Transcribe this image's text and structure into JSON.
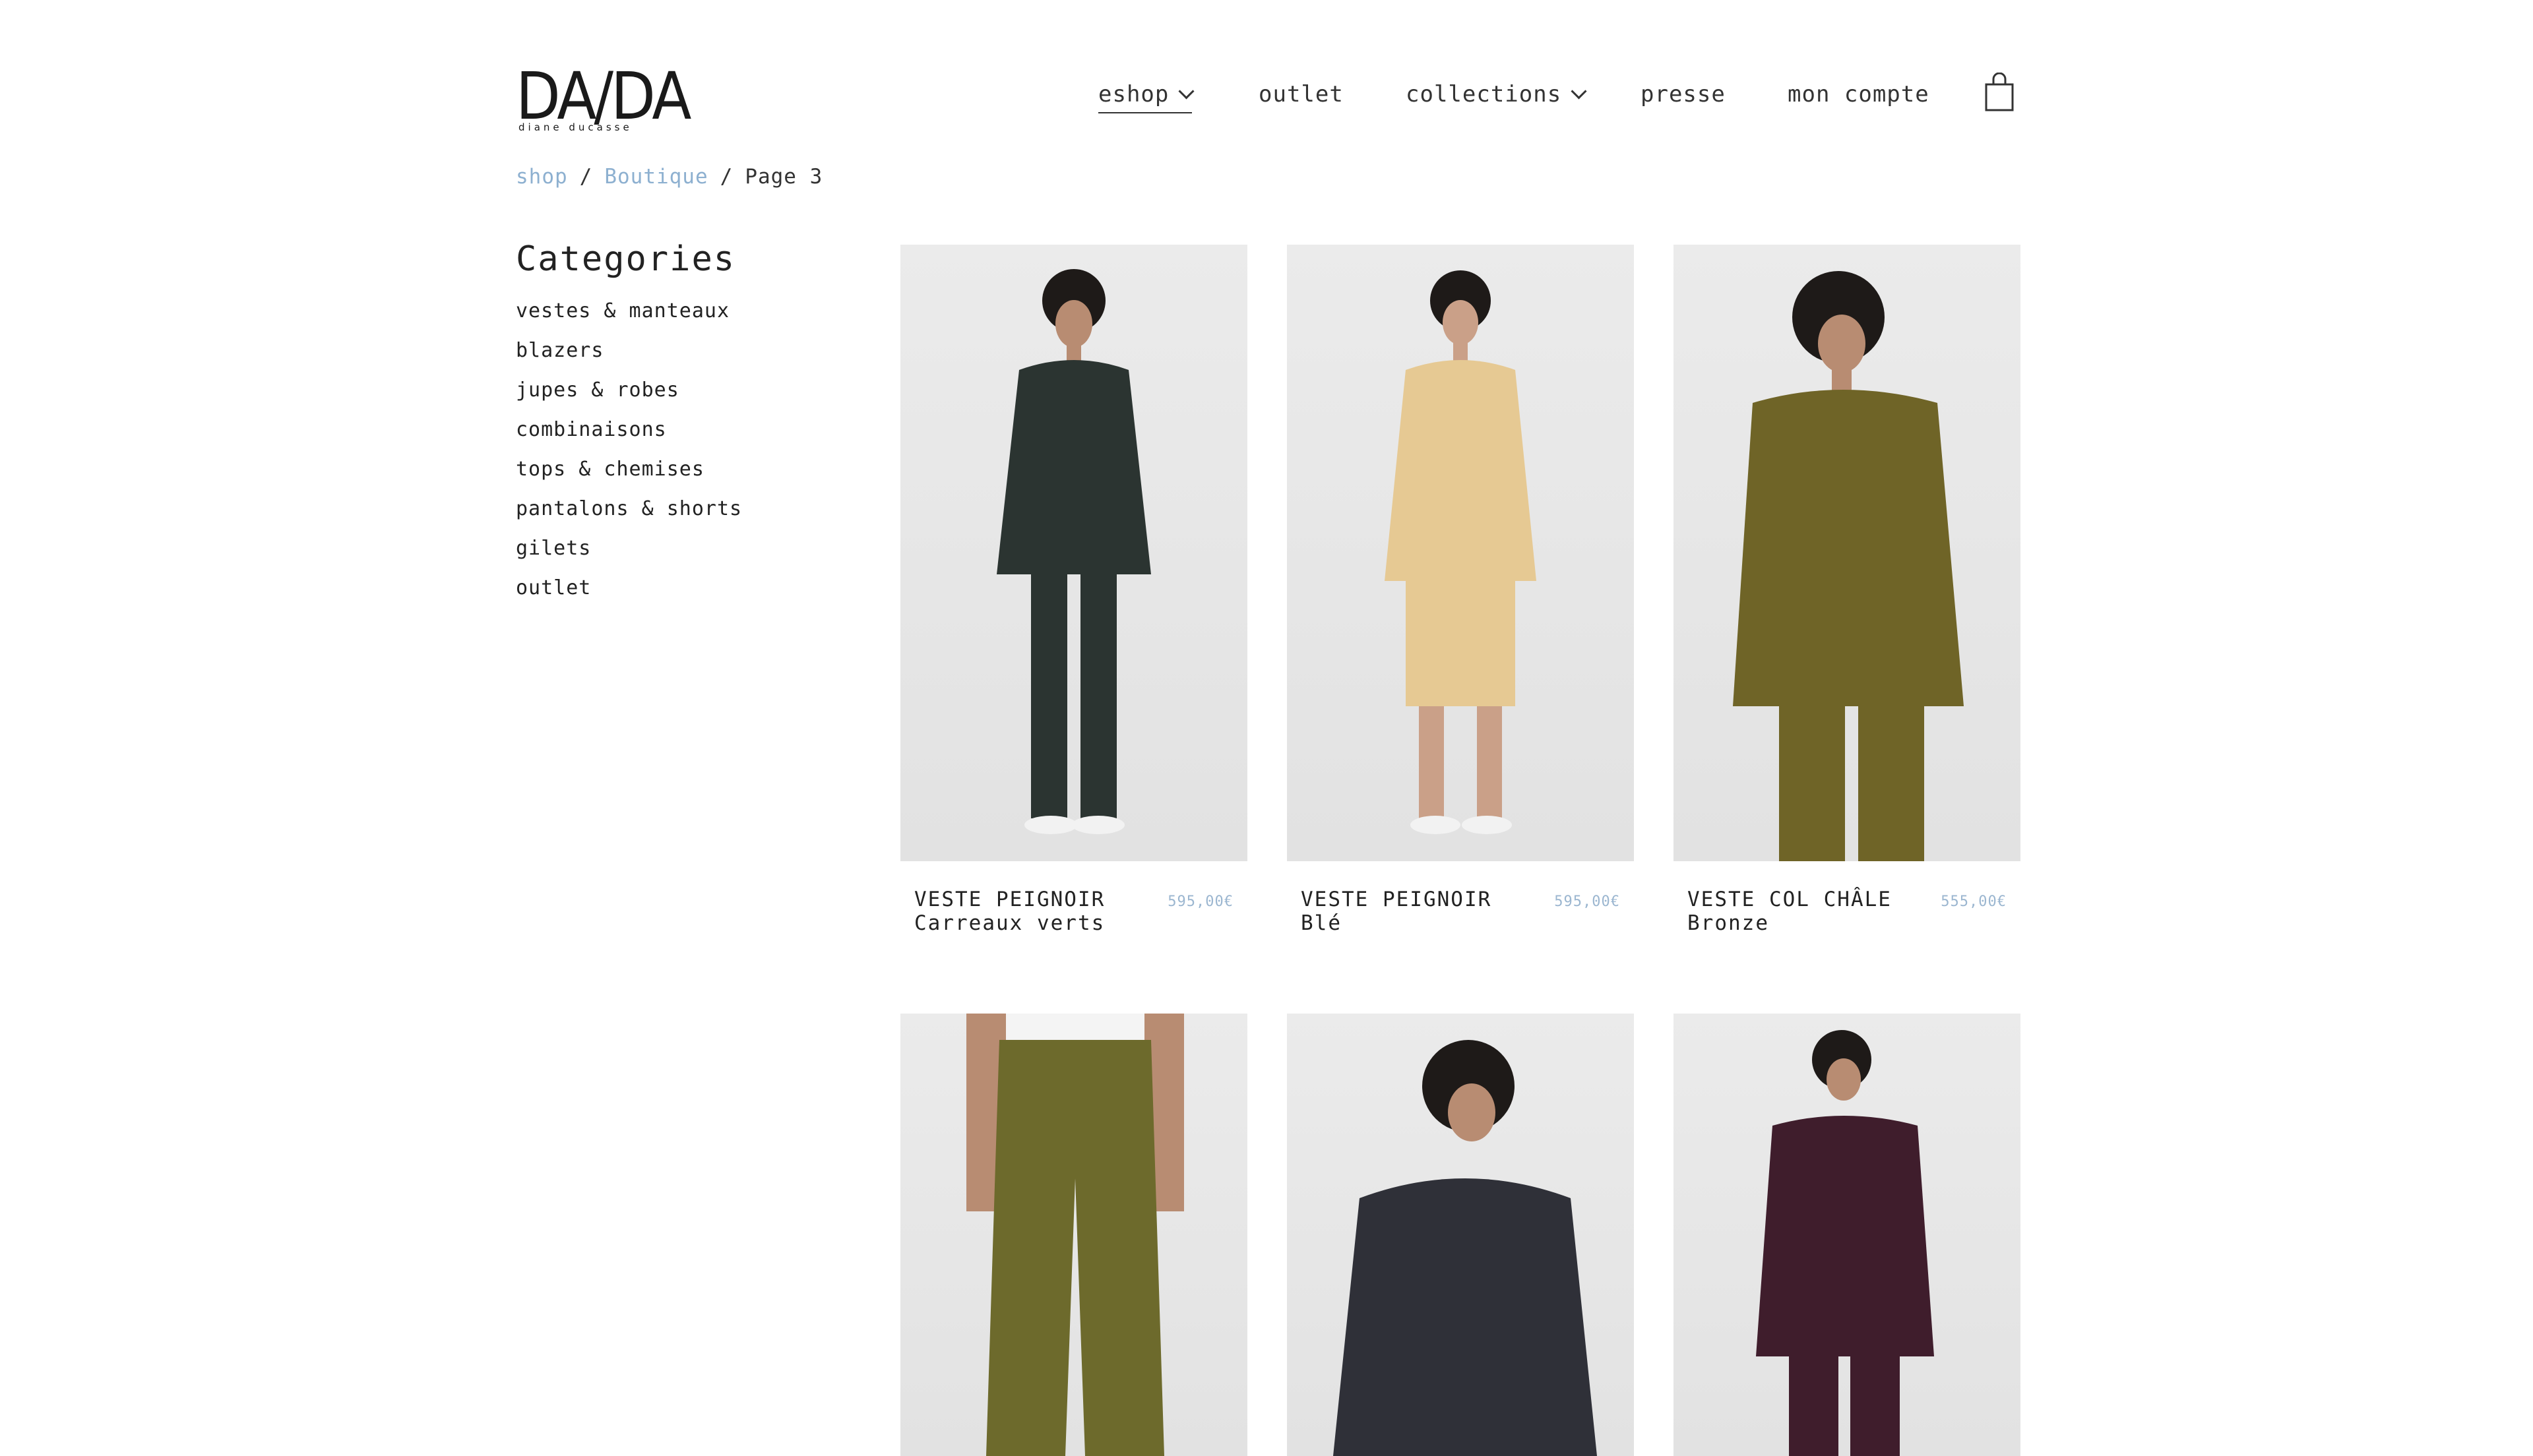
{
  "brand": {
    "name": "DA/DA",
    "tagline": "diane ducasse"
  },
  "nav": {
    "eshop": "eshop",
    "outlet": "outlet",
    "collections": "collections",
    "presse": "presse",
    "account": "mon compte"
  },
  "breadcrumb": {
    "shop": "shop",
    "sep": "/",
    "boutique": "Boutique",
    "current": "Page 3"
  },
  "sidebar": {
    "title": "Categories",
    "items": [
      "vestes & manteaux",
      "blazers",
      "jupes & robes",
      "combinaisons",
      "tops & chemises",
      "pantalons & shorts",
      "gilets",
      "outlet"
    ]
  },
  "products": [
    {
      "name": "VESTE PEIGNOIR",
      "variant": "Carreaux verts",
      "price": "595,00€",
      "color": "#2b3431"
    },
    {
      "name": "VESTE PEIGNOIR",
      "variant": "Blé",
      "price": "595,00€",
      "color": "#e6c993"
    },
    {
      "name": "VESTE COL CHÂLE",
      "variant": "Bronze",
      "price": "555,00€",
      "color": "#6f6427"
    },
    {
      "color": "#6d6a2c"
    },
    {
      "color": "#2f3038"
    },
    {
      "color": "#3f1d2c"
    }
  ],
  "colors": {
    "link": "#8db0d0",
    "price": "#9bb6d0",
    "text": "#222222"
  }
}
